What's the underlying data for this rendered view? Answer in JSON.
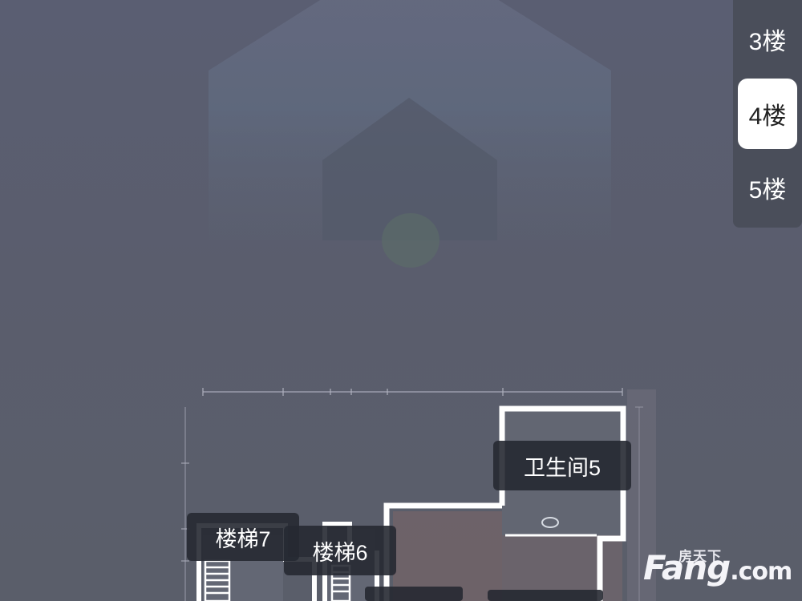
{
  "floor_selector": {
    "floors": [
      {
        "label": "3楼",
        "active": false
      },
      {
        "label": "4楼",
        "active": true
      },
      {
        "label": "5楼",
        "active": false
      }
    ]
  },
  "rooms": {
    "bathroom_5": "卫生间5",
    "stairs_7": "楼梯7",
    "stairs_6": "楼梯6"
  },
  "watermark": {
    "top_text": "房天下",
    "brand": "Fang",
    "domain": ".com"
  },
  "colors": {
    "accent_white": "#ffffff",
    "panel": "#4a4e5a",
    "label_bg": "#262932"
  }
}
